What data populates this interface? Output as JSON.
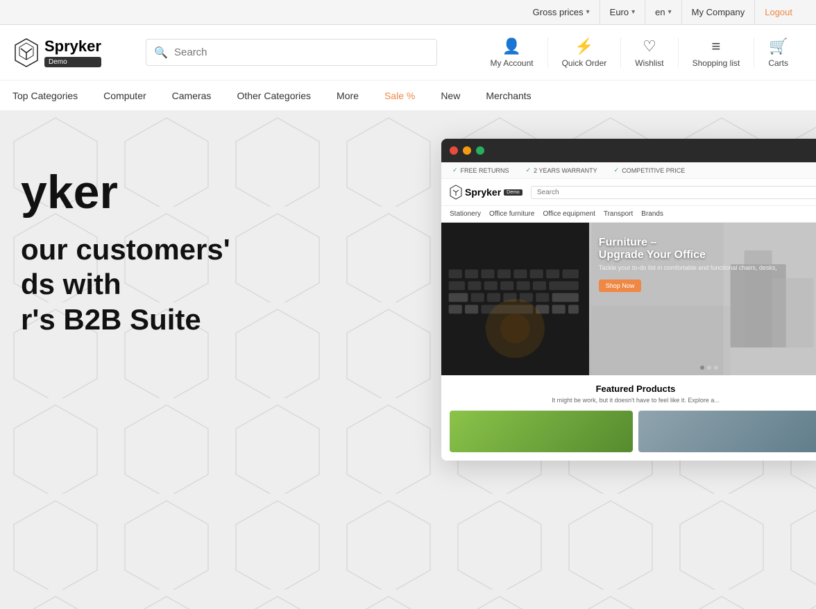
{
  "topbar": {
    "gross_prices": "Gross prices",
    "euro": "Euro",
    "lang": "en",
    "company": "My Company",
    "logout": "Logout"
  },
  "header": {
    "logo_text": "Spryker",
    "logo_badge": "Demo",
    "search_placeholder": "Search",
    "actions": [
      {
        "id": "my-account",
        "icon": "👤",
        "label": "My Account"
      },
      {
        "id": "quick-order",
        "icon": "🛒",
        "label": "Quick Order"
      },
      {
        "id": "wishlist",
        "icon": "♡",
        "label": "Wishlist"
      },
      {
        "id": "shopping-list",
        "icon": "☰",
        "label": "Shopping list"
      },
      {
        "id": "carts",
        "icon": "🛒",
        "label": "Carts"
      }
    ]
  },
  "nav": {
    "items": [
      {
        "id": "top-categories",
        "label": "Top Categories",
        "sale": false
      },
      {
        "id": "computer",
        "label": "Computer",
        "sale": false
      },
      {
        "id": "cameras",
        "label": "Cameras",
        "sale": false
      },
      {
        "id": "other-categories",
        "label": "Other Categories",
        "sale": false
      },
      {
        "id": "more",
        "label": "More",
        "sale": false
      },
      {
        "id": "sale",
        "label": "Sale %",
        "sale": true
      },
      {
        "id": "new",
        "label": "New",
        "sale": false
      },
      {
        "id": "merchants",
        "label": "Merchants",
        "sale": false
      }
    ]
  },
  "hero": {
    "title_line1": "yker",
    "subtitle_line1": "our customers'",
    "subtitle_line2": "ds with",
    "subtitle_line3": "r's B2B Suite"
  },
  "browser_mockup": {
    "inner_nav_items": [
      "Stationery",
      "Office furniture",
      "Office equipment",
      "Transport",
      "Brands"
    ],
    "inner_hero_title": "Furniture –\nUpgrade Your Office",
    "inner_hero_sub": "Tackle your to-do list in comfortable and functional chairs, desks,",
    "inner_shop_btn": "Shop Now",
    "featured_title": "Featured Products",
    "featured_sub": "It might be work, but it doesn't have to feel like it. Explore a...",
    "checks": [
      "FREE RETURNS",
      "2 YEARS WARRANTY",
      "COMPETITIVE PRICE"
    ]
  }
}
